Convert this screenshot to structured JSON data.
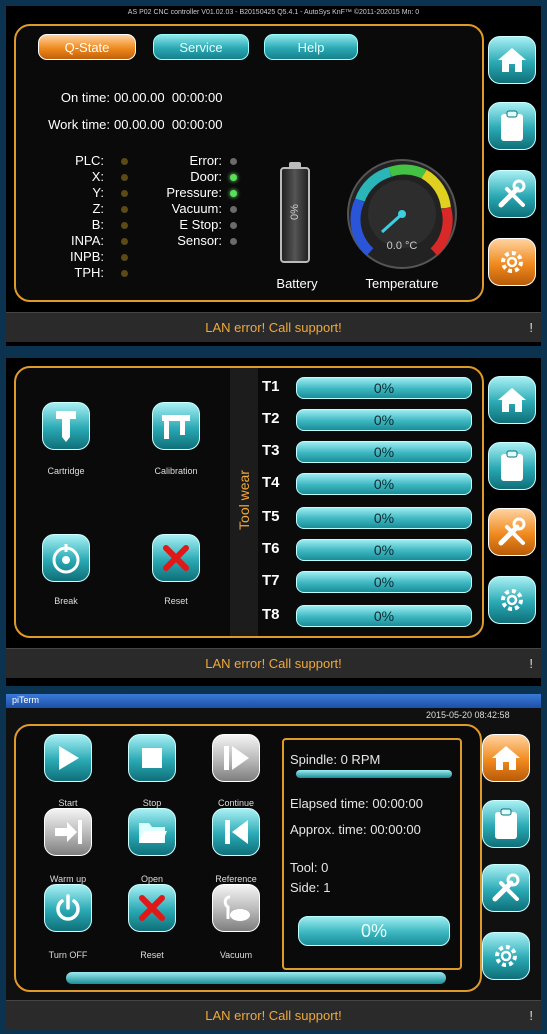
{
  "screen1": {
    "title": "AS P02 CNC controller V01.02.03 - B20150425 Q5.4.1 - AutoSys KnF™ ©2011-202015 Mn: 0",
    "tabs": [
      "Q-State",
      "Service",
      "Help"
    ],
    "on_time_label": "On time:",
    "on_time_value": "00.00.00  00:00:00",
    "work_time_label": "Work time:",
    "work_time_value": "00.00.00  00:00:00",
    "left_signals": [
      "PLC:",
      "X:",
      "Y:",
      "Z:",
      "B:",
      "INPA:",
      "INPB:",
      "TPH:"
    ],
    "right_signals": [
      {
        "label": "Error:",
        "state": "grey"
      },
      {
        "label": "Door:",
        "state": "green"
      },
      {
        "label": "Pressure:",
        "state": "green"
      },
      {
        "label": "Vacuum:",
        "state": "grey"
      },
      {
        "label": "E Stop:",
        "state": "grey"
      },
      {
        "label": "Sensor:",
        "state": "grey"
      }
    ],
    "battery_value": "0%",
    "battery_level": 0,
    "battery_label": "Battery",
    "temperature_value": "0.0 °C",
    "temperature_label": "Temperature",
    "status": "LAN error! Call support!",
    "status_mark": "!"
  },
  "screen2": {
    "actions": [
      {
        "label": "Cartridge",
        "icon": "cartridge-icon"
      },
      {
        "label": "Calibration",
        "icon": "calibration-icon"
      },
      {
        "label": "Break",
        "icon": "break-icon"
      },
      {
        "label": "Reset",
        "icon": "reset-icon"
      }
    ],
    "tool_wear_label": "Tool wear",
    "tools": [
      {
        "name": "T1",
        "value": "0%"
      },
      {
        "name": "T2",
        "value": "0%"
      },
      {
        "name": "T3",
        "value": "0%"
      },
      {
        "name": "T4",
        "value": "0%"
      },
      {
        "name": "T5",
        "value": "0%"
      },
      {
        "name": "T6",
        "value": "0%"
      },
      {
        "name": "T7",
        "value": "0%"
      },
      {
        "name": "T8",
        "value": "0%"
      }
    ],
    "status": "LAN error! Call support!",
    "status_mark": "!"
  },
  "screen3": {
    "window_title": "piTerm",
    "datetime": "2015-05-20 08:42:58",
    "controls": [
      {
        "label": "Start",
        "icon": "play-icon"
      },
      {
        "label": "Stop",
        "icon": "stop-icon"
      },
      {
        "label": "Continue",
        "icon": "continue-icon"
      },
      {
        "label": "Warm up",
        "icon": "warm-up-icon"
      },
      {
        "label": "Open",
        "icon": "open-folder-icon"
      },
      {
        "label": "Reference",
        "icon": "reference-icon"
      },
      {
        "label": "Turn OFF",
        "icon": "power-icon"
      },
      {
        "label": "Reset",
        "icon": "reset-icon"
      },
      {
        "label": "Vacuum",
        "icon": "vacuum-icon"
      }
    ],
    "spindle": "Spindle: 0 RPM",
    "elapsed": "Elapsed time: 00:00:00",
    "approx": "Approx. time: 00:00:00",
    "tool": "Tool: 0",
    "side": "Side: 1",
    "progress": "0%",
    "status": "LAN error! Call support!",
    "status_mark": "!"
  },
  "nav": [
    "home-icon",
    "clipboard-icon",
    "tools-icon",
    "gear-icon"
  ],
  "colors": {
    "accent_orange": "#e09a2a",
    "teal": "#2aa9b4",
    "status_text": "#f0a93a"
  }
}
